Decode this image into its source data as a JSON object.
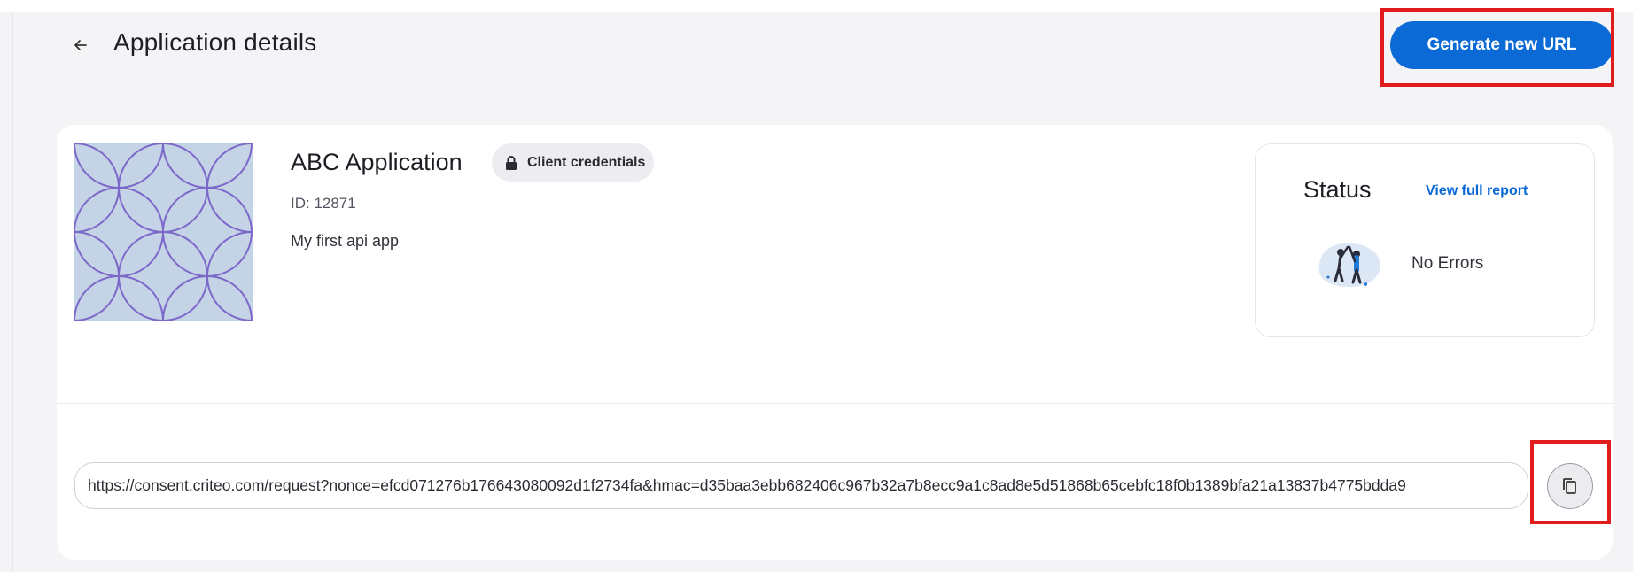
{
  "header": {
    "back_icon": "arrow-left-icon",
    "title": "Application details",
    "generate_button": "Generate new URL"
  },
  "application": {
    "name": "ABC Application",
    "badge": {
      "icon": "lock-icon",
      "label": "Client credentials"
    },
    "id_text": "ID: 12871",
    "description": "My first api app"
  },
  "status": {
    "title": "Status",
    "link": "View full report",
    "illustration": "high-five-illustration",
    "text": "No Errors"
  },
  "consent_url": {
    "value": "https://consent.criteo.com/request?nonce=efcd071276b176643080092d1f2734fa&hmac=d35baa3ebb682406c967b32a7b8ecc9a1c8ad8e5d51868b65cebfc18f0b1389bfa21a13837b4775bdda9",
    "copy_icon": "copy-icon"
  },
  "colors": {
    "accent": "#0b6ad6",
    "highlight": "#e01c1c",
    "image_bg": "#c4d3e6",
    "image_pattern": "#7b68c9"
  }
}
